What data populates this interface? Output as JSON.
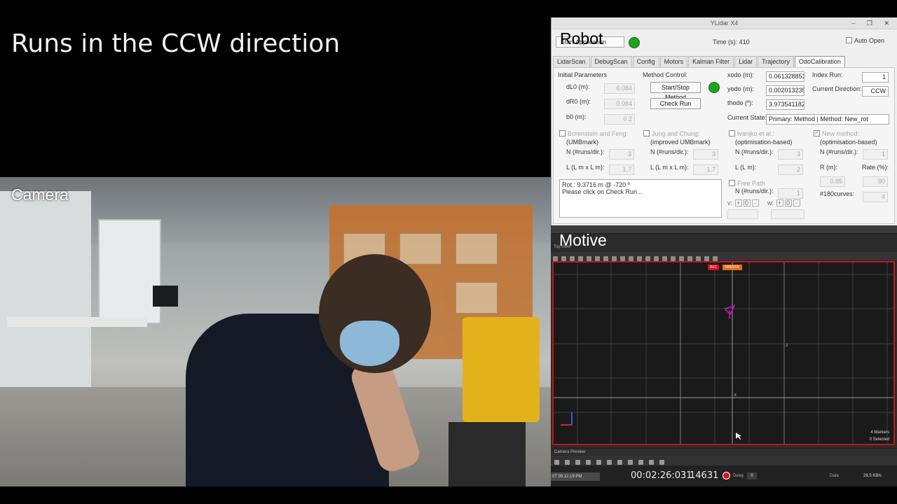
{
  "caption": {
    "title": "Runs in the CCW direction"
  },
  "camera": {
    "label": "Camera"
  },
  "robot_window": {
    "overlay_label": "Robot",
    "title": "YLidar X4",
    "window_controls": "– ❐ ✕",
    "start_button": "Start Application",
    "time_label": "Time (s): 410",
    "auto_open": "Auto Open",
    "status_color": "#1ea51e",
    "tabs": [
      "LidarScan",
      "DebugScan",
      "Config",
      "Motors",
      "Kalman Filter",
      "Lidar",
      "Trajectory",
      "OdoCalibration"
    ],
    "active_tab": "OdoCalibration",
    "initial_params": {
      "heading": "Initial Parameters",
      "dL0_label": "dL0 (m):",
      "dL0": "0.084",
      "dR0_label": "dR0 (m):",
      "dR0": "0.084",
      "b0_label": "b0 (m):",
      "b0": "0.2"
    },
    "method_control": {
      "heading": "Method Control:",
      "start_stop": "Start/Stop Method",
      "check_run": "Check Run"
    },
    "odometry": {
      "xodo_label": "xodo (m):",
      "xodo": "0.0613288519",
      "yodo_label": "yodo (m):",
      "yodo": "0.0020132351",
      "thodo_label": "thodo (º):",
      "thodo": "3.9735411826",
      "state_label": "Current State:",
      "state": "Primary: Method | Method: New_rot"
    },
    "index_run": {
      "label": "Index Run:",
      "value": "1"
    },
    "direction": {
      "label": "Current Direction:",
      "value": "CCW"
    },
    "methods": {
      "borenstein": {
        "title": "Borenstein and Feng:",
        "sub": "(UMBmark)",
        "n_label": "N (#runs/dir.):",
        "n": "3",
        "l_label": "L (L m x L m):",
        "l": "1.7"
      },
      "jung": {
        "title": "Jung and Chung:",
        "sub": "(improved UMBmark)",
        "n_label": "N (#runs/dir.):",
        "n": "3",
        "l_label": "L (L m x L m):",
        "l": "1.7"
      },
      "ivanjko": {
        "title": "Ivanjko et al.:",
        "sub": "(optimisation-based)",
        "n_label": "N (#runs/dir.):",
        "n": "3",
        "l_label": "L (L m):",
        "l": "2"
      },
      "new": {
        "title": "New method:",
        "sub": "(optimisation-based)",
        "n_label": "N (#runs/dir.):",
        "n": "1",
        "r_label": "R (m):",
        "r": "0.85",
        "rate_label": "Rate (%):",
        "rate": "90",
        "curves_label": "#180curves:",
        "curves": "4"
      },
      "free_path": {
        "title": "Free Path",
        "n_label": "N (#runs/dir.):",
        "n": "1",
        "v_label": "v:",
        "v": "0",
        "w_label": "w:",
        "w": "0"
      }
    },
    "log_lines": [
      "Rot.: 9.3716 m @ -720 º",
      "Please click on Check Run..."
    ]
  },
  "motive": {
    "overlay_label": "Motive",
    "view_title": "Top View",
    "rec": "REC",
    "passive": "PASSIVE",
    "axis_z": "z",
    "axis_x": "x",
    "markers": "4 Markers",
    "selected": "0 Selected",
    "camera_preview": "Camera Preview",
    "date": "07 09.12.19 PM",
    "timecode": "00:02:26:031",
    "frame": "14631",
    "delay_label": "Delay",
    "delay": "0",
    "data_label": "Data",
    "data_rate": "29.5 KB/s",
    "accent": "#c4141d",
    "marker_color": "#c11ab5"
  }
}
